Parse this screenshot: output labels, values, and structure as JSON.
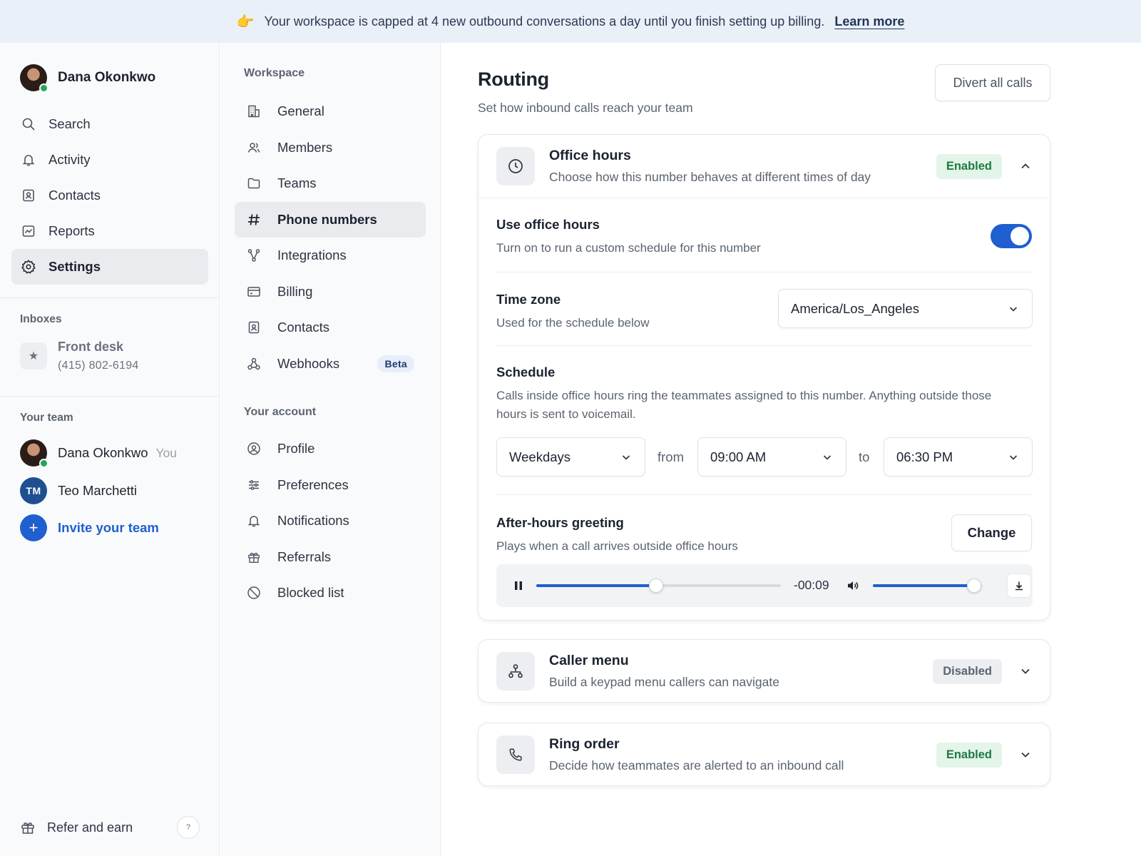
{
  "banner": {
    "emoji": "👉",
    "message": "Your workspace is capped at 4 new outbound conversations a day until you finish setting up billing.",
    "link": "Learn more"
  },
  "sidebar": {
    "user_name": "Dana Okonkwo",
    "items": [
      {
        "label": "Search",
        "icon": "search-icon"
      },
      {
        "label": "Activity",
        "icon": "bell-icon"
      },
      {
        "label": "Contacts",
        "icon": "contact-icon"
      },
      {
        "label": "Reports",
        "icon": "chart-icon"
      },
      {
        "label": "Settings",
        "icon": "gear-icon",
        "active": true
      }
    ],
    "inboxes_label": "Inboxes",
    "inbox": {
      "name": "Front desk",
      "number": "(415) 802-6194"
    },
    "team_label": "Your team",
    "team": [
      {
        "name": "Dana Okonkwo",
        "suffix": "You"
      },
      {
        "name": "Teo Marchetti",
        "initials": "TM"
      }
    ],
    "invite_label": "Invite your team",
    "refer_label": "Refer and earn",
    "help_label": "?"
  },
  "subnav": {
    "workspace_label": "Workspace",
    "workspace_items": [
      {
        "label": "General",
        "icon": "building-icon"
      },
      {
        "label": "Members",
        "icon": "members-icon"
      },
      {
        "label": "Teams",
        "icon": "folder-icon"
      },
      {
        "label": "Phone numbers",
        "icon": "hash-icon",
        "active": true
      },
      {
        "label": "Integrations",
        "icon": "integrations-icon"
      },
      {
        "label": "Billing",
        "icon": "card-icon"
      },
      {
        "label": "Contacts",
        "icon": "contact-icon"
      },
      {
        "label": "Webhooks",
        "icon": "webhook-icon",
        "badge": "Beta"
      }
    ],
    "account_label": "Your account",
    "account_items": [
      {
        "label": "Profile",
        "icon": "profile-icon"
      },
      {
        "label": "Preferences",
        "icon": "sliders-icon"
      },
      {
        "label": "Notifications",
        "icon": "bell-icon"
      },
      {
        "label": "Referrals",
        "icon": "gift-icon"
      },
      {
        "label": "Blocked list",
        "icon": "blocked-icon"
      }
    ]
  },
  "main": {
    "title": "Routing",
    "subtitle": "Set how inbound calls reach your team",
    "divert_label": "Divert all calls",
    "office_hours": {
      "title": "Office hours",
      "subtitle": "Choose how this number behaves at different times of day",
      "status": "Enabled",
      "expanded": true,
      "use_title": "Use office hours",
      "use_sub": "Turn on to run a custom schedule for this number",
      "use_on": true,
      "tz_title": "Time zone",
      "tz_sub": "Used for the schedule below",
      "tz_value": "America/Los_Angeles",
      "schedule_title": "Schedule",
      "schedule_sub": "Calls inside office hours ring the teammates assigned to this number. Anything outside those hours is sent to voicemail.",
      "days_value": "Weekdays",
      "from_label": "from",
      "from_value": "09:00 AM",
      "to_label": "to",
      "to_value": "06:30 PM",
      "greeting_title": "After-hours greeting",
      "greeting_sub": "Plays when a call arrives outside office hours",
      "change_label": "Change",
      "player": {
        "time_remaining": "-00:09",
        "progress": 0.49,
        "volume": 0.93
      }
    },
    "caller_menu": {
      "title": "Caller menu",
      "subtitle": "Build a keypad menu callers can navigate",
      "status": "Disabled"
    },
    "ring_order": {
      "title": "Ring order",
      "subtitle": "Decide how teammates are alerted to an inbound call",
      "status": "Enabled"
    }
  },
  "colors": {
    "accent": "#1f5fcf",
    "banner_bg": "#eaf0f8",
    "enabled_bg": "#e3f4e8",
    "enabled_text": "#1f7a44",
    "online": "#22a45d"
  }
}
